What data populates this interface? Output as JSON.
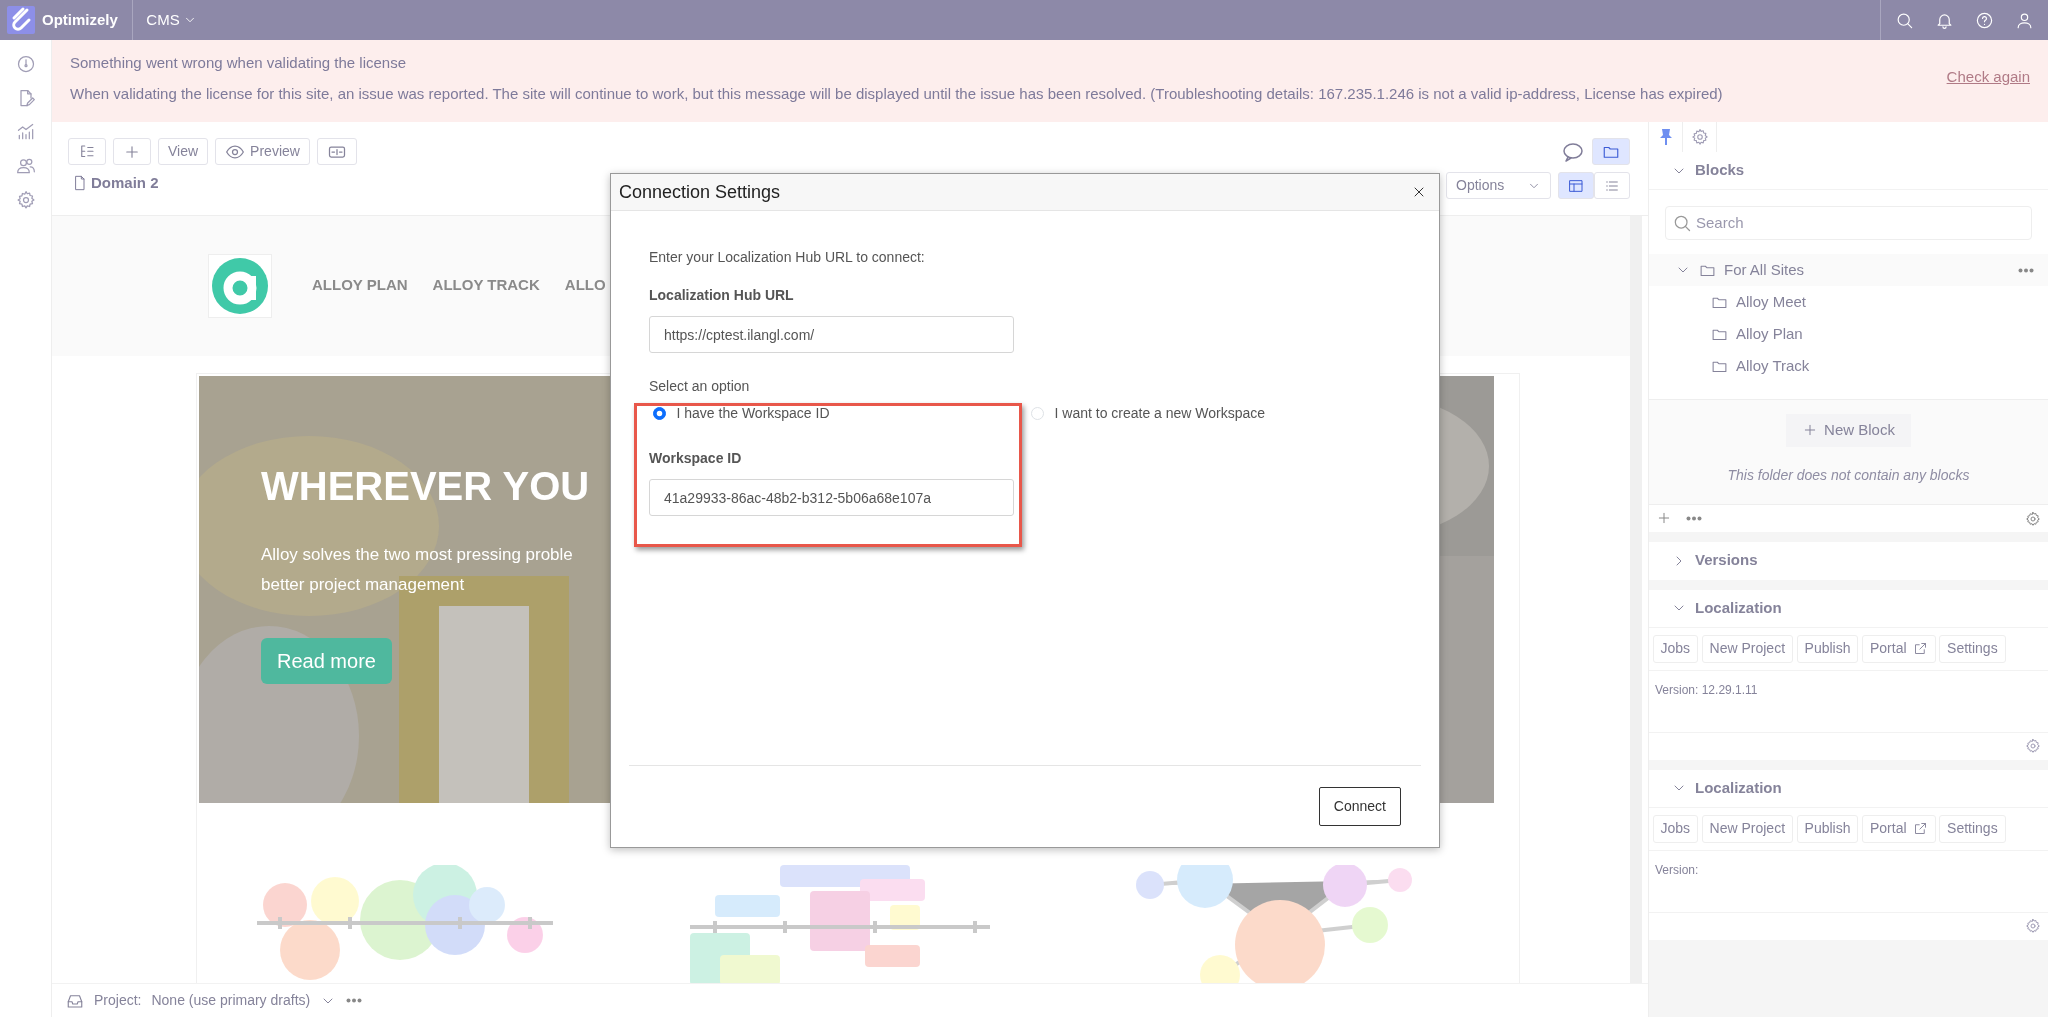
{
  "top_bar": {
    "brand": "Optimizely",
    "app_menu": "CMS"
  },
  "alert": {
    "title": "Something went wrong when validating the license",
    "message": "When validating the license for this site, an issue was reported. The site will continue to work, but this message will be displayed until the issue has been resolved. (Troubleshooting details: 167.235.1.246 is not a valid ip-address, License has expired)",
    "action": "Check again"
  },
  "toolbar": {
    "buttons": [
      {
        "kind": "tree"
      },
      {
        "kind": "add"
      },
      {
        "kind": "text",
        "label": "View"
      },
      {
        "kind": "preview",
        "label": "Preview"
      },
      {
        "kind": "split"
      }
    ],
    "page_title": "Domain 2",
    "options": "Options"
  },
  "preview": {
    "nav": [
      "ALLOY PLAN",
      "ALLOY TRACK",
      "ALLO"
    ],
    "hero": {
      "heading": "WHEREVER YOU",
      "lines": [
        "Alloy solves the two most pressing proble",
        "better project management"
      ],
      "button": "Read more"
    }
  },
  "bottom_bar": {
    "label": "Project:",
    "value": "None (use primary drafts)"
  },
  "right_panel": {
    "tabs": [
      {
        "kind": "pin",
        "selected": true
      },
      {
        "kind": "settings",
        "selected": false
      }
    ],
    "blocks": {
      "title": "Blocks",
      "expanded": true,
      "search_placeholder": "Search",
      "tree": [
        {
          "label": "For All Sites",
          "expanded": true,
          "children": [
            {
              "label": "Alloy Meet"
            },
            {
              "label": "Alloy Plan"
            },
            {
              "label": "Alloy Track"
            }
          ]
        }
      ],
      "new_block": "New Block",
      "empty_text": "This folder does not contain any blocks"
    },
    "versions": {
      "title": "Versions",
      "expanded": false
    },
    "localization": [
      {
        "title": "Localization",
        "expanded": true,
        "buttons": [
          {
            "label": "Jobs",
            "external": false
          },
          {
            "label": "New Project",
            "external": false
          },
          {
            "label": "Publish",
            "external": false
          },
          {
            "label": "Portal",
            "external": true
          },
          {
            "label": "Settings",
            "external": false
          }
        ],
        "version": "Version: 12.29.1.11"
      },
      {
        "title": "Localization",
        "expanded": true,
        "buttons": [
          {
            "label": "Jobs",
            "external": false
          },
          {
            "label": "New Project",
            "external": false
          },
          {
            "label": "Publish",
            "external": false
          },
          {
            "label": "Portal",
            "external": true
          },
          {
            "label": "Settings",
            "external": false
          }
        ],
        "version": "Version:"
      }
    ]
  },
  "dialog": {
    "title": "Connection Settings",
    "intro": "Enter your Localization Hub URL to connect:",
    "url_label": "Localization Hub URL",
    "url_value": "https://cptest.ilangl.com/",
    "option_label": "Select an option",
    "options": [
      {
        "label": "I have the Workspace ID",
        "selected": true
      },
      {
        "label": "I want to create a new Workspace",
        "selected": false
      }
    ],
    "workspace_label": "Workspace ID",
    "workspace_value": "41a29933-86ac-48b2-b312-5b06a68e107a",
    "button": "Connect"
  }
}
